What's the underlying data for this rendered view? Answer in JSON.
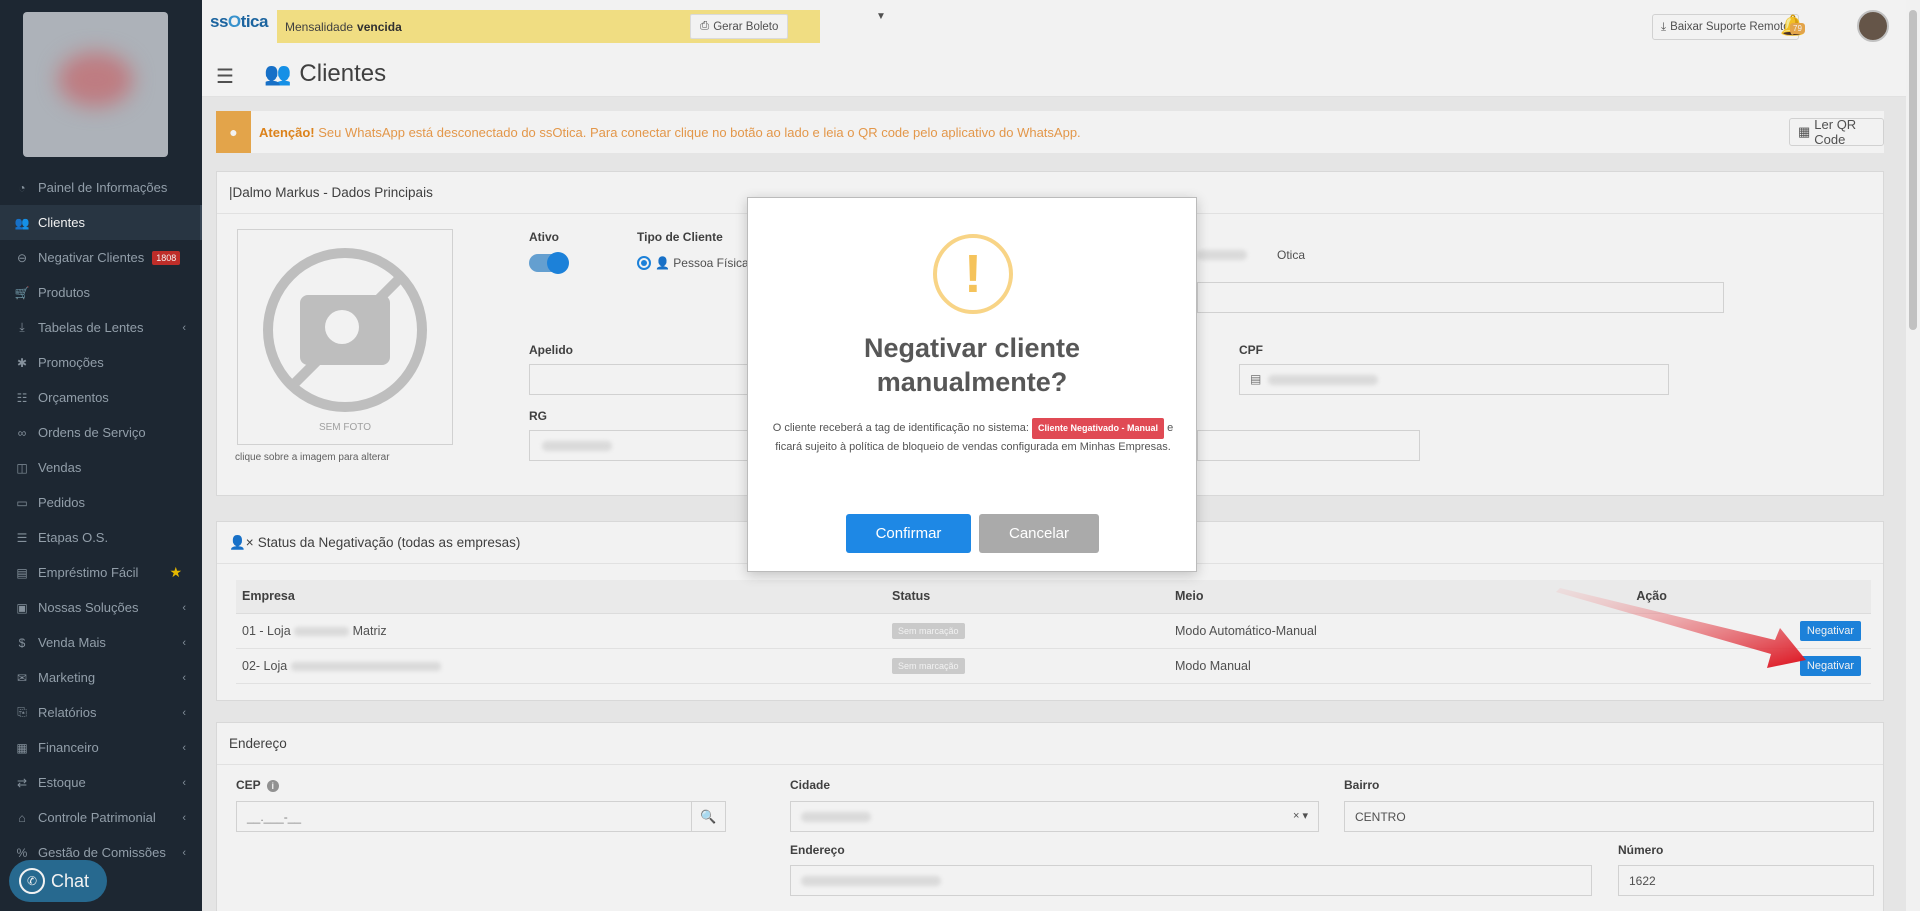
{
  "sidebar": {
    "items": [
      {
        "label": "Painel de Informações",
        "icon": "dashboard-icon",
        "glyph": "◔",
        "active": false
      },
      {
        "label": "Clientes",
        "icon": "users-icon",
        "glyph": "👥",
        "active": true
      },
      {
        "label": "Negativar Clientes",
        "icon": "user-minus-icon",
        "glyph": "⊖",
        "badge": "1808"
      },
      {
        "label": "Produtos",
        "icon": "cart-icon",
        "glyph": "🛒"
      },
      {
        "label": "Tabelas de Lentes",
        "icon": "download-icon",
        "glyph": "⤓",
        "submenu": true
      },
      {
        "label": "Promoções",
        "icon": "asterisk-icon",
        "glyph": "✱"
      },
      {
        "label": "Orçamentos",
        "icon": "clipboard-icon",
        "glyph": "☷"
      },
      {
        "label": "Ordens de Serviço",
        "icon": "glasses-icon",
        "glyph": "∞"
      },
      {
        "label": "Vendas",
        "icon": "basket-icon",
        "glyph": "◫"
      },
      {
        "label": "Pedidos",
        "icon": "inbox-icon",
        "glyph": "▭"
      },
      {
        "label": "Etapas O.S.",
        "icon": "list-icon",
        "glyph": "☰"
      },
      {
        "label": "Empréstimo Fácil",
        "icon": "money-icon",
        "glyph": "▤",
        "star": true
      },
      {
        "label": "Nossas Soluções",
        "icon": "box-icon",
        "glyph": "▣",
        "submenu": true
      },
      {
        "label": "Venda Mais",
        "icon": "dollar-icon",
        "glyph": "$",
        "submenu": true
      },
      {
        "label": "Marketing",
        "icon": "comments-icon",
        "glyph": "✉",
        "submenu": true
      },
      {
        "label": "Relatórios",
        "icon": "copy-icon",
        "glyph": "⎘",
        "submenu": true
      },
      {
        "label": "Financeiro",
        "icon": "cash-icon",
        "glyph": "▦",
        "submenu": true
      },
      {
        "label": "Estoque",
        "icon": "exchange-icon",
        "glyph": "⇄",
        "submenu": true
      },
      {
        "label": "Controle Patrimonial",
        "icon": "building-icon",
        "glyph": "⌂",
        "submenu": true
      },
      {
        "label": "Gestão de Comissões",
        "icon": "percent-icon",
        "glyph": "%",
        "submenu": true
      }
    ],
    "chat_label": "Chat"
  },
  "topbar": {
    "logo": {
      "a": "ss",
      "b": "O",
      "c": "tica"
    },
    "alert_prefix": "Mensalidade",
    "alert_bold": "vencida",
    "boleto_label": "Gerar Boleto",
    "suporte_label": "Baixar Suporte Remoto",
    "bell_count": "79"
  },
  "page": {
    "title": "Clientes"
  },
  "callout": {
    "bold": "Atenção!",
    "text": "Seu WhatsApp está desconectado do ssOtica. Para conectar clique no botão ao lado e leia o QR code pelo aplicativo do WhatsApp.",
    "qr_label": "Ler QR Code"
  },
  "dados": {
    "heading": "|Dalmo Markus - Dados Principais",
    "sem_foto": "SEM FOTO",
    "photo_hint": "clique sobre a imagem para alterar",
    "ativo_label": "Ativo",
    "tipo_label": "Tipo de Cliente",
    "tipo_value": "Pessoa Física",
    "otica": "Otica",
    "apelido_label": "Apelido",
    "cpf_label": "CPF",
    "rg_label": "RG"
  },
  "negativacao": {
    "heading": "Status da Negativação (todas as empresas)",
    "columns": [
      "Empresa",
      "Status",
      "Meio",
      "Ação"
    ],
    "rows": [
      {
        "empresa_a": "01 - Loja",
        "empresa_b": "Matriz",
        "status": "Sem marcação",
        "meio": "Modo Automático-Manual",
        "acao": "Negativar"
      },
      {
        "empresa_a": "02- Loja",
        "empresa_b": "",
        "status": "Sem marcação",
        "meio": "Modo Manual",
        "acao": "Negativar"
      }
    ]
  },
  "endereco": {
    "heading": "Endereço",
    "cep_label": "CEP",
    "cep_placeholder": "__.___-__",
    "cidade_label": "Cidade",
    "bairro_label": "Bairro",
    "bairro_value": "CENTRO",
    "endereco_label": "Endereço",
    "numero_label": "Número",
    "numero_value": "1622"
  },
  "modal": {
    "icon": "!",
    "title": "Negativar cliente manualmente?",
    "body_before": "O cliente receberá a tag de identificação no sistema:",
    "tag": "Cliente Negativado - Manual",
    "body_after": "e ficará sujeito à política de bloqueio de vendas configurada em Minhas Empresas.",
    "confirm": "Confirmar",
    "cancel": "Cancelar"
  }
}
